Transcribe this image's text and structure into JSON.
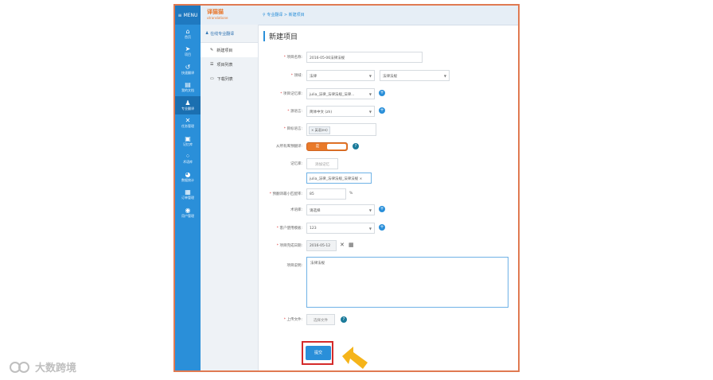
{
  "sidebar": {
    "menu_label": "MENU",
    "items": [
      {
        "label": "首页",
        "icon": "home-icon"
      },
      {
        "label": "项目",
        "icon": "send-icon"
      },
      {
        "label": "快速翻译",
        "icon": "history-icon"
      },
      {
        "label": "我的文档",
        "icon": "document-icon"
      },
      {
        "label": "专业翻译",
        "icon": "users-icon"
      },
      {
        "label": "任务管理",
        "icon": "tools-icon"
      },
      {
        "label": "记忆库",
        "icon": "chip-icon"
      },
      {
        "label": "术语库",
        "icon": "grid-icon"
      },
      {
        "label": "数据统计",
        "icon": "pie-icon"
      },
      {
        "label": "订单管理",
        "icon": "clipboard-icon"
      },
      {
        "label": "用户管理",
        "icon": "user-icon"
      }
    ]
  },
  "header": {
    "logo_cn": "译猫猫",
    "logo_en": "utranslatione",
    "breadcrumb": "专业翻译 > 新建项目"
  },
  "subnav": {
    "title": "在线专业翻译",
    "items": [
      "新建项目",
      "项目列表",
      "下载列表"
    ]
  },
  "form": {
    "page_title": "新建项目",
    "project_name_label": "项目名称",
    "project_name_value": "2016-05-06法律法规",
    "domain_label": "领域",
    "domain_value": "法律",
    "subdomain_value": "法律法规",
    "memory_label": "项目记忆库",
    "memory_value": "julia_法律_法律法规_法律...",
    "source_lang_label": "源语言",
    "source_lang_value": "简体中文 (zh)",
    "target_lang_label": "目标语言",
    "target_lang_tag": "× 英语(en)",
    "pretranslate_label": "从所有库预翻译",
    "toggle_on_label": "是",
    "memlib_label": "记忆库",
    "add_memlib_label": "添加记忆",
    "memlib_tag": "julia_法律_法律法规_法律法规 ×",
    "match_label": "预翻译最小匹配率",
    "match_value": "85",
    "match_unit": "%",
    "termbase_label": "术语库",
    "termbase_value": "请选择",
    "client_label": "客户使用模板",
    "client_value": "123",
    "deadline_label": "项目完成日期",
    "deadline_value": "2016-05-12",
    "desc_label": "项目说明",
    "desc_value": "法律法规",
    "upload_label": "上传文件",
    "upload_button": "选择文件",
    "submit_label": "提交"
  },
  "watermark": "大数跨境",
  "colors": {
    "sidebar": "#2a8fd9",
    "accent_orange": "#e97a2a",
    "highlight_red": "#d42a2a",
    "arrow_yellow": "#f5b41a"
  }
}
